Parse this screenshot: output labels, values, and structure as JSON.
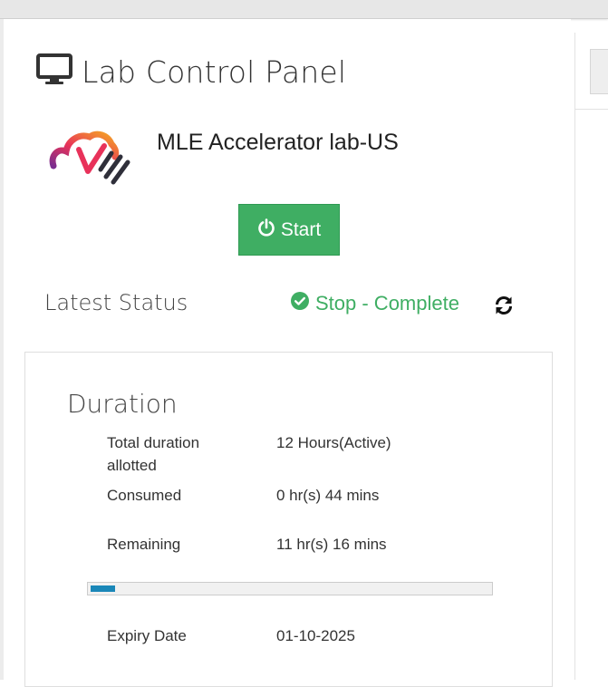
{
  "panel": {
    "title": "Lab Control Panel",
    "icon": "monitor-icon"
  },
  "lab": {
    "name": "MLE Accelerator lab-US",
    "logo": "cloud-check-logo"
  },
  "actions": {
    "start_label": "Start",
    "start_icon": "power-icon",
    "start_color": "#3fae63"
  },
  "status": {
    "label": "Latest Status",
    "value": "Stop - Complete",
    "icon": "check-circle-icon",
    "color": "#3fae63",
    "refresh_icon": "refresh-icon"
  },
  "duration": {
    "title": "Duration",
    "rows": [
      {
        "label": "Total duration allotted",
        "value": "12 Hours(Active)"
      },
      {
        "label": "Consumed",
        "value": "0 hr(s) 44 mins"
      },
      {
        "label": "Remaining",
        "value": "11 hr(s) 16 mins"
      }
    ],
    "progress_fraction": 0.061,
    "progress_color": "#1a87b8",
    "expiry_label": "Expiry Date",
    "expiry_value": "01-10-2025"
  }
}
